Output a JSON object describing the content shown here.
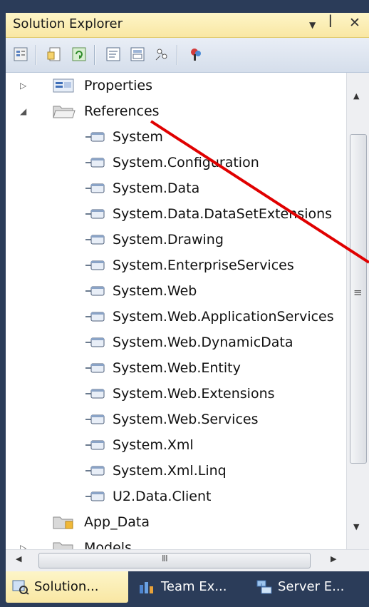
{
  "window": {
    "title": "Solution Explorer",
    "dropdown_glyph": "▼",
    "pin_glyph": "ꟾ",
    "close_glyph": "✕"
  },
  "toolbar": {
    "icons": [
      "properties-icon",
      "show-all-files-icon",
      "refresh-icon",
      "view-code-icon",
      "view-designer-icon",
      "view-class-diagram-icon",
      "add-reference-icon"
    ]
  },
  "tree": {
    "properties_label": "Properties",
    "references_label": "References",
    "references": [
      "System",
      "System.Configuration",
      "System.Data",
      "System.Data.DataSetExtensions",
      "System.Drawing",
      "System.EnterpriseServices",
      "System.Web",
      "System.Web.ApplicationServices",
      "System.Web.DynamicData",
      "System.Web.Entity",
      "System.Web.Extensions",
      "System.Web.Services",
      "System.Xml",
      "System.Xml.Linq",
      "U2.Data.Client"
    ],
    "app_data_label": "App_Data",
    "models_label": "Models"
  },
  "scrollbars": {
    "up_glyph": "▲",
    "down_glyph": "▼",
    "left_glyph": "◀",
    "right_glyph": "▶",
    "grip_glyph": "≡",
    "hgrip_glyph": "III"
  },
  "tabs": [
    {
      "label": "Solution...",
      "icon": "solution-explorer-icon"
    },
    {
      "label": "Team Ex...",
      "icon": "team-explorer-icon"
    },
    {
      "label": "Server E...",
      "icon": "server-explorer-icon"
    }
  ],
  "colors": {
    "title_bg": "#f9e7a3",
    "annotation_line": "#e00000",
    "tab_strip": "#2b3c59"
  }
}
